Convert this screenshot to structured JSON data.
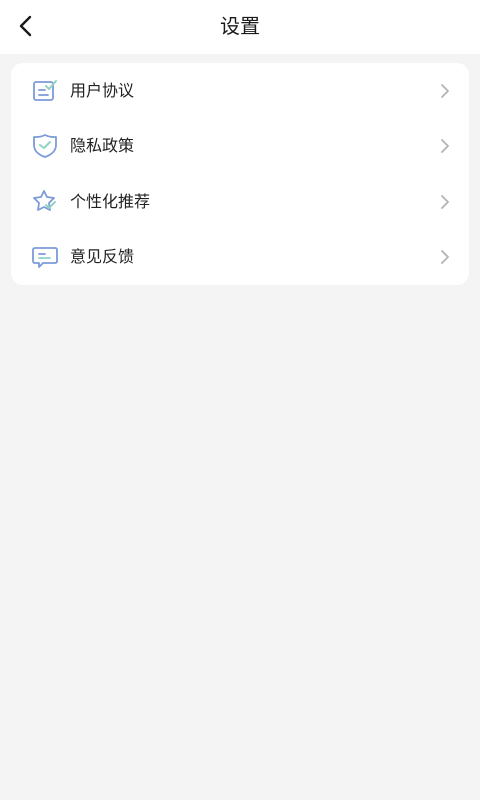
{
  "header": {
    "title": "设置",
    "back_icon": "back-arrow-icon"
  },
  "settings": {
    "items": [
      {
        "label": "用户协议",
        "icon": "document-check-icon"
      },
      {
        "label": "隐私政策",
        "icon": "shield-check-icon"
      },
      {
        "label": "个性化推荐",
        "icon": "star-sparkle-icon"
      },
      {
        "label": "意见反馈",
        "icon": "message-icon"
      }
    ]
  },
  "colors": {
    "background": "#f4f4f4",
    "card": "#ffffff",
    "icon_accent": "#7b9bd9",
    "icon_check": "#8fd3c6",
    "chevron": "#b3b3b3"
  }
}
